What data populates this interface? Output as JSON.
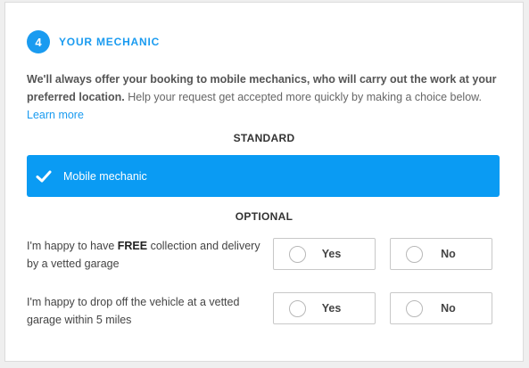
{
  "step": {
    "number": "4",
    "title": "YOUR MECHANIC"
  },
  "intro": {
    "bold_text": "We'll always offer your booking to mobile mechanics, who will carry out the work at your preferred location.",
    "text": " Help your request get accepted more quickly by making a choice below. ",
    "link": "Learn more"
  },
  "standard": {
    "label": "STANDARD",
    "selected_option": "Mobile mechanic",
    "accent_color": "#0a9bf3"
  },
  "optional": {
    "label": "OPTIONAL",
    "questions": [
      {
        "text_before": "I'm happy to have ",
        "text_bold": "FREE",
        "text_after": " collection and delivery by a vetted garage",
        "yes_label": "Yes",
        "no_label": "No"
      },
      {
        "text_before": "I'm happy to drop off the vehicle at a vetted garage within 5 miles",
        "text_bold": "",
        "text_after": "",
        "yes_label": "Yes",
        "no_label": "No"
      }
    ]
  }
}
